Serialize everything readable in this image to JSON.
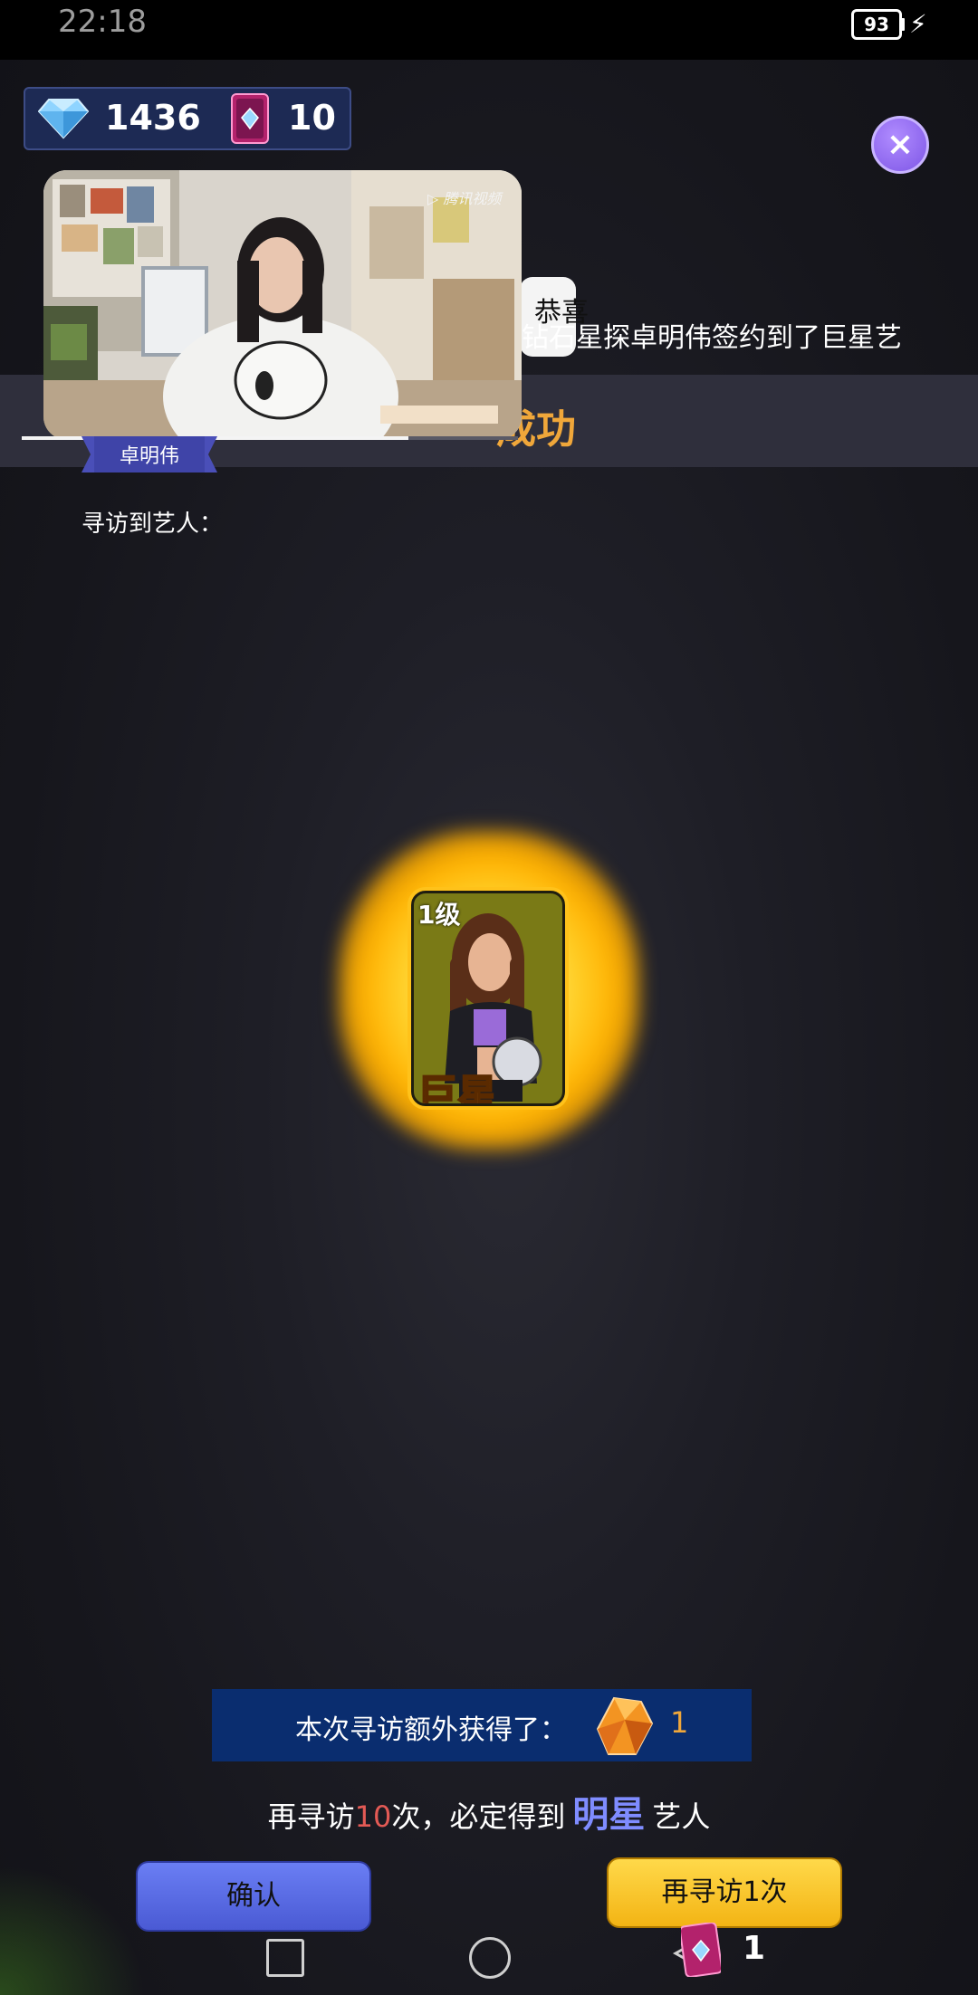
{
  "status_bar": {
    "time": "22:18",
    "battery": "93"
  },
  "currency": {
    "diamond_icon": "diamond-icon",
    "diamonds": "1436",
    "card_icon": "visit-card-icon",
    "cards": "10"
  },
  "close_icon": "×",
  "ticker": {
    "pill_text": "恭喜",
    "message": "钻石星探卓明伟签约到了巨星艺人"
  },
  "title": "成功",
  "video": {
    "watermark": "▷ 腾讯视频",
    "progress": 0.78,
    "name_tag": "卓明伟"
  },
  "visited_label": "寻访到艺人：",
  "artist_card": {
    "level": "1级",
    "rank": "巨星",
    "background": "#7a7a16"
  },
  "bonus": {
    "text": "本次寻访额外获得了：",
    "icon": "orange-gem-icon",
    "count": "1"
  },
  "guarantee": {
    "prefix": "再寻访",
    "count": "10",
    "middle": "次，必定得到",
    "rank": "明星",
    "suffix": "艺人"
  },
  "buttons": {
    "confirm": "确认",
    "revisit": "再寻访1次"
  },
  "floating": {
    "count": "1"
  },
  "colors": {
    "accent_orange": "#f0a73a",
    "confirm_blue": "#5a6ae4",
    "revisit_yellow": "#f7c52c",
    "close_purple": "#8f66f0"
  }
}
